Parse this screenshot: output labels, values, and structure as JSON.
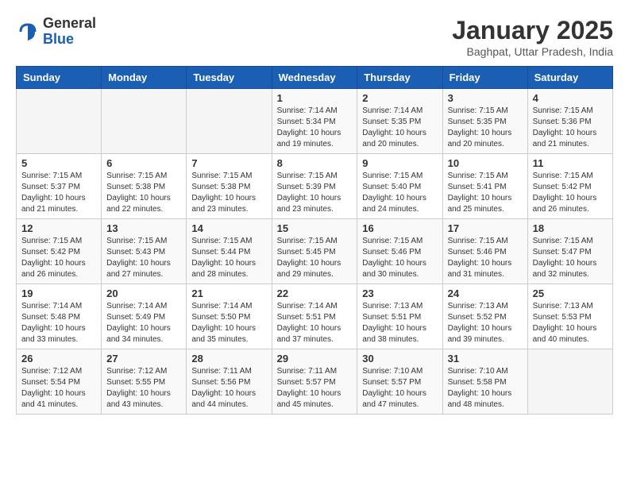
{
  "header": {
    "logo_line1": "General",
    "logo_line2": "Blue",
    "month_title": "January 2025",
    "subtitle": "Baghpat, Uttar Pradesh, India"
  },
  "days_of_week": [
    "Sunday",
    "Monday",
    "Tuesday",
    "Wednesday",
    "Thursday",
    "Friday",
    "Saturday"
  ],
  "weeks": [
    [
      {
        "day": "",
        "sunrise": "",
        "sunset": "",
        "daylight": ""
      },
      {
        "day": "",
        "sunrise": "",
        "sunset": "",
        "daylight": ""
      },
      {
        "day": "",
        "sunrise": "",
        "sunset": "",
        "daylight": ""
      },
      {
        "day": "1",
        "sunrise": "Sunrise: 7:14 AM",
        "sunset": "Sunset: 5:34 PM",
        "daylight": "Daylight: 10 hours and 19 minutes."
      },
      {
        "day": "2",
        "sunrise": "Sunrise: 7:14 AM",
        "sunset": "Sunset: 5:35 PM",
        "daylight": "Daylight: 10 hours and 20 minutes."
      },
      {
        "day": "3",
        "sunrise": "Sunrise: 7:15 AM",
        "sunset": "Sunset: 5:35 PM",
        "daylight": "Daylight: 10 hours and 20 minutes."
      },
      {
        "day": "4",
        "sunrise": "Sunrise: 7:15 AM",
        "sunset": "Sunset: 5:36 PM",
        "daylight": "Daylight: 10 hours and 21 minutes."
      }
    ],
    [
      {
        "day": "5",
        "sunrise": "Sunrise: 7:15 AM",
        "sunset": "Sunset: 5:37 PM",
        "daylight": "Daylight: 10 hours and 21 minutes."
      },
      {
        "day": "6",
        "sunrise": "Sunrise: 7:15 AM",
        "sunset": "Sunset: 5:38 PM",
        "daylight": "Daylight: 10 hours and 22 minutes."
      },
      {
        "day": "7",
        "sunrise": "Sunrise: 7:15 AM",
        "sunset": "Sunset: 5:38 PM",
        "daylight": "Daylight: 10 hours and 23 minutes."
      },
      {
        "day": "8",
        "sunrise": "Sunrise: 7:15 AM",
        "sunset": "Sunset: 5:39 PM",
        "daylight": "Daylight: 10 hours and 23 minutes."
      },
      {
        "day": "9",
        "sunrise": "Sunrise: 7:15 AM",
        "sunset": "Sunset: 5:40 PM",
        "daylight": "Daylight: 10 hours and 24 minutes."
      },
      {
        "day": "10",
        "sunrise": "Sunrise: 7:15 AM",
        "sunset": "Sunset: 5:41 PM",
        "daylight": "Daylight: 10 hours and 25 minutes."
      },
      {
        "day": "11",
        "sunrise": "Sunrise: 7:15 AM",
        "sunset": "Sunset: 5:42 PM",
        "daylight": "Daylight: 10 hours and 26 minutes."
      }
    ],
    [
      {
        "day": "12",
        "sunrise": "Sunrise: 7:15 AM",
        "sunset": "Sunset: 5:42 PM",
        "daylight": "Daylight: 10 hours and 26 minutes."
      },
      {
        "day": "13",
        "sunrise": "Sunrise: 7:15 AM",
        "sunset": "Sunset: 5:43 PM",
        "daylight": "Daylight: 10 hours and 27 minutes."
      },
      {
        "day": "14",
        "sunrise": "Sunrise: 7:15 AM",
        "sunset": "Sunset: 5:44 PM",
        "daylight": "Daylight: 10 hours and 28 minutes."
      },
      {
        "day": "15",
        "sunrise": "Sunrise: 7:15 AM",
        "sunset": "Sunset: 5:45 PM",
        "daylight": "Daylight: 10 hours and 29 minutes."
      },
      {
        "day": "16",
        "sunrise": "Sunrise: 7:15 AM",
        "sunset": "Sunset: 5:46 PM",
        "daylight": "Daylight: 10 hours and 30 minutes."
      },
      {
        "day": "17",
        "sunrise": "Sunrise: 7:15 AM",
        "sunset": "Sunset: 5:46 PM",
        "daylight": "Daylight: 10 hours and 31 minutes."
      },
      {
        "day": "18",
        "sunrise": "Sunrise: 7:15 AM",
        "sunset": "Sunset: 5:47 PM",
        "daylight": "Daylight: 10 hours and 32 minutes."
      }
    ],
    [
      {
        "day": "19",
        "sunrise": "Sunrise: 7:14 AM",
        "sunset": "Sunset: 5:48 PM",
        "daylight": "Daylight: 10 hours and 33 minutes."
      },
      {
        "day": "20",
        "sunrise": "Sunrise: 7:14 AM",
        "sunset": "Sunset: 5:49 PM",
        "daylight": "Daylight: 10 hours and 34 minutes."
      },
      {
        "day": "21",
        "sunrise": "Sunrise: 7:14 AM",
        "sunset": "Sunset: 5:50 PM",
        "daylight": "Daylight: 10 hours and 35 minutes."
      },
      {
        "day": "22",
        "sunrise": "Sunrise: 7:14 AM",
        "sunset": "Sunset: 5:51 PM",
        "daylight": "Daylight: 10 hours and 37 minutes."
      },
      {
        "day": "23",
        "sunrise": "Sunrise: 7:13 AM",
        "sunset": "Sunset: 5:51 PM",
        "daylight": "Daylight: 10 hours and 38 minutes."
      },
      {
        "day": "24",
        "sunrise": "Sunrise: 7:13 AM",
        "sunset": "Sunset: 5:52 PM",
        "daylight": "Daylight: 10 hours and 39 minutes."
      },
      {
        "day": "25",
        "sunrise": "Sunrise: 7:13 AM",
        "sunset": "Sunset: 5:53 PM",
        "daylight": "Daylight: 10 hours and 40 minutes."
      }
    ],
    [
      {
        "day": "26",
        "sunrise": "Sunrise: 7:12 AM",
        "sunset": "Sunset: 5:54 PM",
        "daylight": "Daylight: 10 hours and 41 minutes."
      },
      {
        "day": "27",
        "sunrise": "Sunrise: 7:12 AM",
        "sunset": "Sunset: 5:55 PM",
        "daylight": "Daylight: 10 hours and 43 minutes."
      },
      {
        "day": "28",
        "sunrise": "Sunrise: 7:11 AM",
        "sunset": "Sunset: 5:56 PM",
        "daylight": "Daylight: 10 hours and 44 minutes."
      },
      {
        "day": "29",
        "sunrise": "Sunrise: 7:11 AM",
        "sunset": "Sunset: 5:57 PM",
        "daylight": "Daylight: 10 hours and 45 minutes."
      },
      {
        "day": "30",
        "sunrise": "Sunrise: 7:10 AM",
        "sunset": "Sunset: 5:57 PM",
        "daylight": "Daylight: 10 hours and 47 minutes."
      },
      {
        "day": "31",
        "sunrise": "Sunrise: 7:10 AM",
        "sunset": "Sunset: 5:58 PM",
        "daylight": "Daylight: 10 hours and 48 minutes."
      },
      {
        "day": "",
        "sunrise": "",
        "sunset": "",
        "daylight": ""
      }
    ]
  ]
}
